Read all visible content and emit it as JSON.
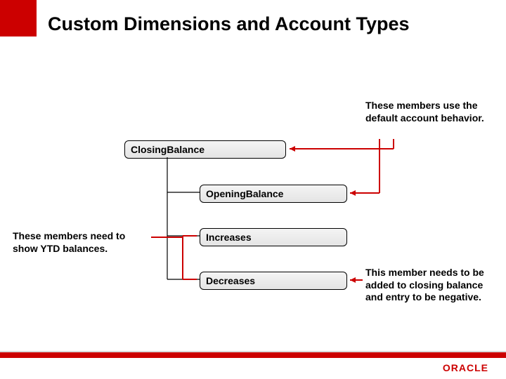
{
  "slide": {
    "title": "Custom Dimensions and Account Types"
  },
  "captions": {
    "top_right": "These members use the default account behavior.",
    "middle_left": "These members need to show YTD balances.",
    "bottom_right": "This member needs to be added to closing balance and entry to be negative."
  },
  "nodes": {
    "closing_balance": "ClosingBalance",
    "opening_balance": "OpeningBalance",
    "increases": "Increases",
    "decreases": "Decreases"
  },
  "brand": {
    "name": "ORACLE",
    "accent_color": "#cc0000"
  }
}
